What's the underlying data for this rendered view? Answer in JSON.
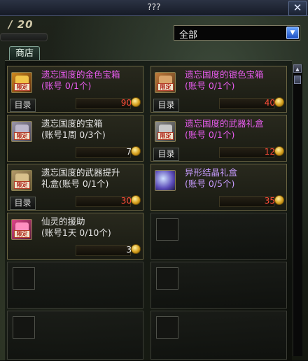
{
  "window": {
    "title": "???",
    "close_label": "✕"
  },
  "counter": "/ 20",
  "filter": {
    "selected": "全部",
    "arrow": "▼"
  },
  "tab": {
    "label": "商店"
  },
  "scrollbar": {
    "up": "▲"
  },
  "items": [
    {
      "name_line1": "遗忘国度的金色宝箱",
      "name_line2": "(账号 0/1个)",
      "name_color": "pink",
      "catalog": "目录",
      "price": "90",
      "price_color": "red",
      "icon": "gold-chest-icon",
      "badge": "限定",
      "icon_colors": [
        "#d08a1f",
        "#5a2b0d"
      ]
    },
    {
      "name_line1": "遗忘国度的银色宝箱",
      "name_line2": "(账号 0/1个)",
      "name_color": "pink",
      "catalog": "目录",
      "price": "40",
      "price_color": "red",
      "icon": "silver-chest-icon",
      "badge": "限定",
      "icon_colors": [
        "#c07a3a",
        "#5a3a1e"
      ]
    },
    {
      "name_line1": "遗忘国度的宝箱",
      "name_line2": "(账号1周 0/3个)",
      "name_color": "white",
      "catalog": "",
      "price": "7",
      "price_color": "white",
      "icon": "chest-icon",
      "badge": "限定",
      "icon_colors": [
        "#9a96a8",
        "#4a4658"
      ]
    },
    {
      "name_line1": "遗忘国度的武器礼盒",
      "name_line2": "(账号 0/1个)",
      "name_color": "pink",
      "catalog": "目录",
      "price": "12",
      "price_color": "red",
      "icon": "weapon-giftbox-icon",
      "badge": "限定",
      "icon_colors": [
        "#8d8d8d",
        "#3a3a3a"
      ]
    },
    {
      "name_line1": "遗忘国度的武器提升",
      "name_line2": "礼盒(账号 0/1个)",
      "name_color": "white",
      "catalog": "目录",
      "price": "30",
      "price_color": "red",
      "icon": "weapon-upgrade-box-icon",
      "badge": "限定",
      "icon_colors": [
        "#b49a6a",
        "#5a4a2a"
      ]
    },
    {
      "name_line1": "异形结晶礼盒",
      "name_line2": "(账号 0/5个)",
      "name_color": "purple",
      "catalog": "",
      "price": "35",
      "price_color": "red",
      "icon": "crystal-orb-icon",
      "badge": "",
      "icon_colors": [
        "#cfe0ff",
        "#5a4ab8"
      ]
    },
    {
      "name_line1": "仙灵的援助",
      "name_line2": "(账号1天 0/10个)",
      "name_color": "white",
      "catalog": "",
      "price": "3",
      "price_color": "white",
      "icon": "fairy-aid-icon",
      "badge": "限定",
      "icon_colors": [
        "#e0468a",
        "#5a1a3a"
      ]
    }
  ]
}
